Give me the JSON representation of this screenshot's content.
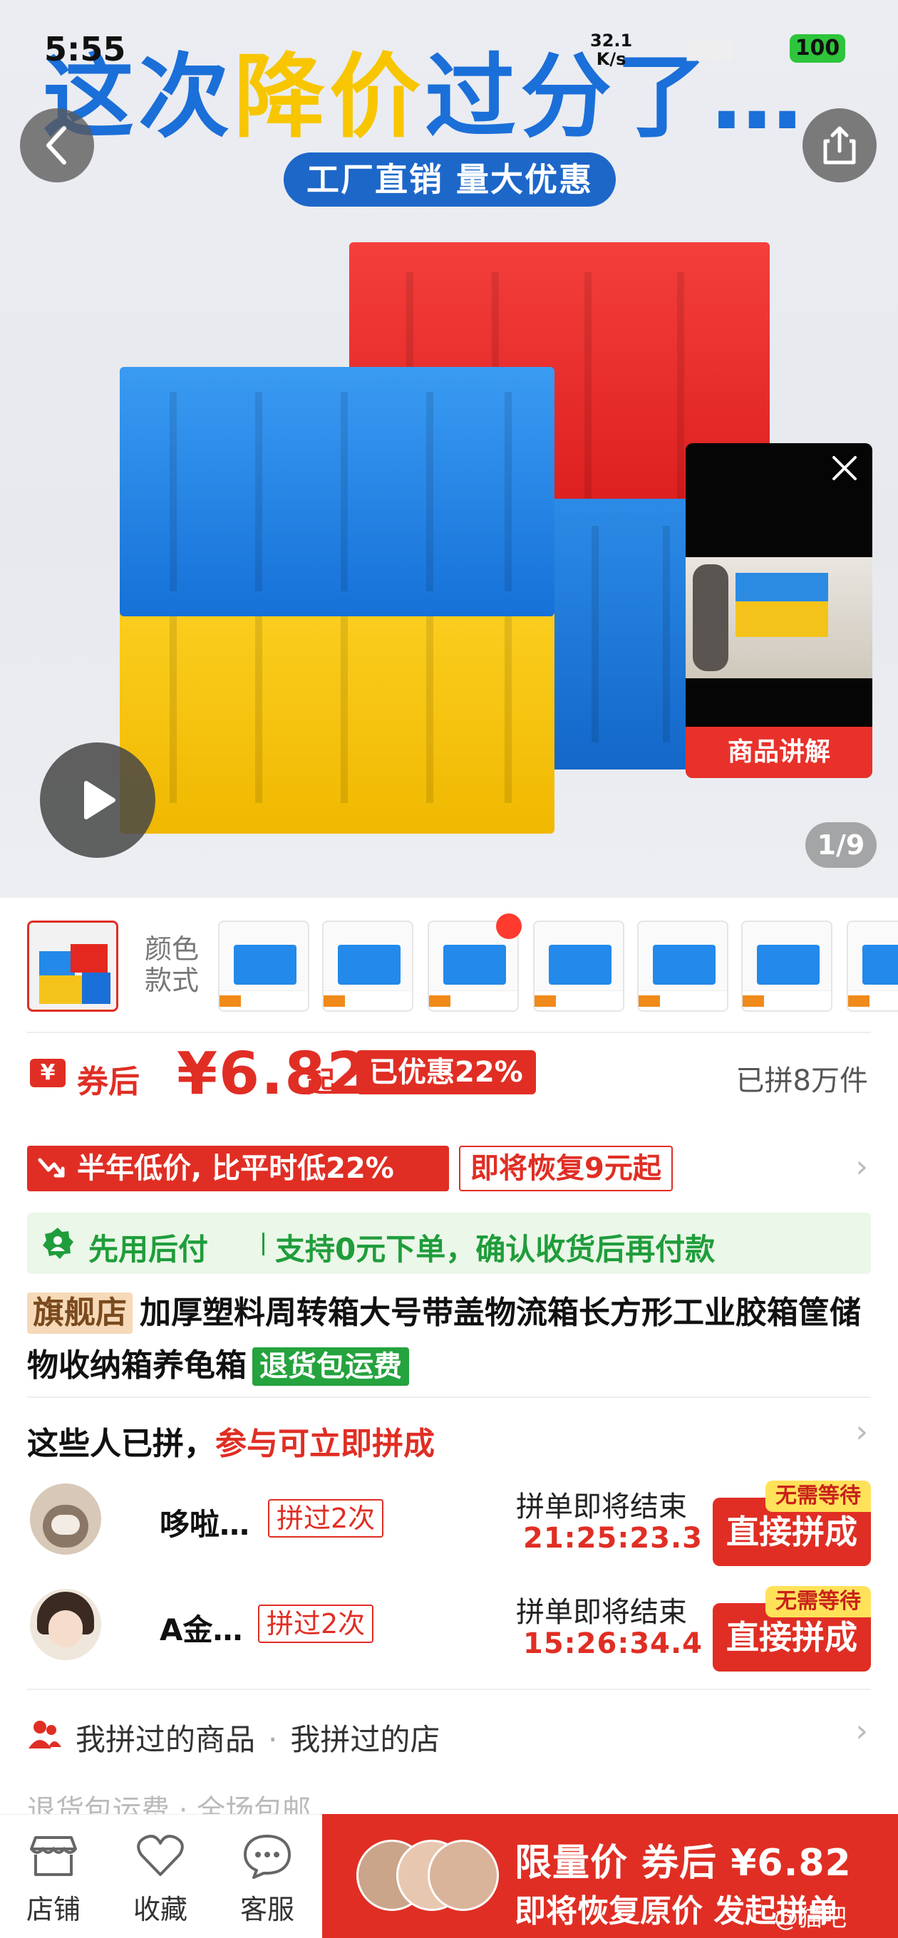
{
  "status_bar": {
    "time": "5:55",
    "speed_value": "32.1",
    "speed_unit": "K/s",
    "battery": "100"
  },
  "hero": {
    "headline_a": "这次",
    "headline_b": "降价",
    "headline_c": "过分了…",
    "tag": "工厂直销 量大优惠",
    "video_label": "商品讲解",
    "page_indicator": "1/9"
  },
  "sku": {
    "color_label": "颜色款式"
  },
  "price": {
    "currency_badge": "¥",
    "after_coupon": "券后",
    "value": "¥6.82",
    "suffix": "起",
    "discount_badge": "已优惠22%",
    "sold_count": "已拼8万件"
  },
  "low_price": {
    "tag": "半年低价, 比平时低22%",
    "restore": "即将恢复9元起"
  },
  "pay_after": {
    "title": "先用后付",
    "desc": "支持0元下单，确认收货后再付款"
  },
  "product": {
    "store_tag": "旗舰店",
    "title": "加厚塑料周转箱大号带盖物流箱长方形工业胶箱筐储物收纳箱养龟箱",
    "return_tag": "退货包运费"
  },
  "group_buy": {
    "title_plain": "这些人已拼，",
    "title_accent": "参与可立即拼成",
    "items": [
      {
        "name": "哆啦…",
        "times": "拼过2次",
        "ending_label": "拼单即将结束",
        "countdown": "21:25:23.3",
        "join_label": "直接拼成",
        "badge": "无需等待"
      },
      {
        "name": "A金…",
        "times": "拼过2次",
        "ending_label": "拼单即将结束",
        "countdown": "15:26:34.4",
        "join_label": "直接拼成",
        "badge": "无需等待"
      }
    ]
  },
  "history": {
    "products": "我拼过的商品",
    "dot": "·",
    "stores": "我拼过的店"
  },
  "bottom_nav": {
    "peek": "退货包运费 · 全场包邮",
    "store": "店铺",
    "favorite": "收藏",
    "service": "客服",
    "cta_line1": "限量价 券后 ¥6.82",
    "cta_line2": "即将恢复原价 发起拼单",
    "watermark": "@猫吧"
  },
  "colors": {
    "accent_red": "#e02e24",
    "green": "#1f9d3b",
    "crate_blue": "#1b6fd8",
    "crate_yellow": "#f7c600"
  }
}
